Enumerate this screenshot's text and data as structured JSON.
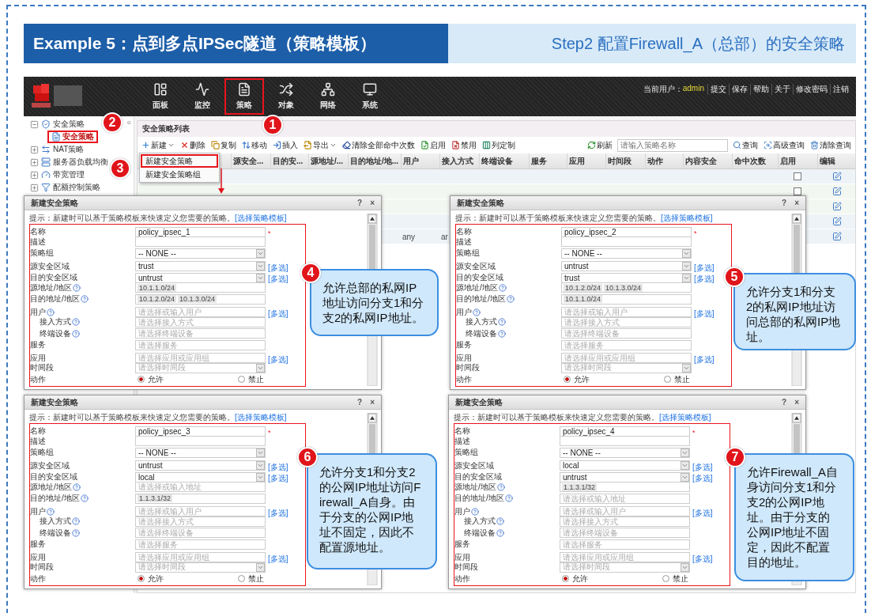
{
  "slide_title": "Example 5：点到多点IPSec隧道（策略模板）",
  "step_title": "Step2 配置Firewall_A（总部）的安全策略",
  "app": {
    "nav": [
      {
        "label": "面板",
        "selected": false
      },
      {
        "label": "监控",
        "selected": false
      },
      {
        "label": "策略",
        "selected": true
      },
      {
        "label": "对象",
        "selected": false
      },
      {
        "label": "网络",
        "selected": false
      },
      {
        "label": "系统",
        "selected": false
      }
    ],
    "user_label": "当前用户：",
    "user": "admin",
    "header_links": [
      "提交",
      "保存",
      "帮助",
      "关于",
      "修改密码",
      "注销"
    ],
    "sidebar": {
      "collapse": "«",
      "items": [
        {
          "label": "安全策略",
          "expanded": true,
          "children": [
            {
              "label": "安全策略",
              "selected": true
            }
          ]
        },
        {
          "label": "NAT策略",
          "expanded": false
        },
        {
          "label": "服务器负载均衡",
          "expanded": false
        },
        {
          "label": "带宽管理",
          "expanded": false
        },
        {
          "label": "配额控制策略",
          "expanded": false
        }
      ]
    },
    "panel_title": "安全策略列表",
    "toolbar": [
      {
        "label": "新建",
        "menu": true
      },
      {
        "label": "删除"
      },
      {
        "label": "复制"
      },
      {
        "label": "移动"
      },
      {
        "label": "插入"
      },
      {
        "label": "导出",
        "menu": true
      },
      {
        "label": "清除全部命中次数"
      },
      {
        "label": "启用"
      },
      {
        "label": "禁用"
      },
      {
        "label": "列定制"
      }
    ],
    "refresh": "刷新",
    "search": {
      "placeholder": "请输入策略名称"
    },
    "query_tools": [
      "查询",
      "高级查询",
      "清除查询"
    ],
    "dropdown": [
      {
        "label": "新建安全策略",
        "selected": true
      },
      {
        "label": "新建安全策略组",
        "selected": false
      }
    ],
    "columns": [
      "源安全...",
      "目的安...",
      "源地址/...",
      "目的地址/地...",
      "用户",
      "接入方式",
      "终端设备",
      "服务",
      "应用",
      "时间段",
      "动作",
      "内容安全",
      "命中次数",
      "启用",
      "编辑"
    ],
    "rows": [
      {
        "enabled": false
      },
      {
        "enabled": false
      },
      {
        "kind": "plain"
      },
      {
        "kind": "plain"
      },
      {
        "user": "any",
        "access": "ar"
      }
    ]
  },
  "dialogs": [
    {
      "title": "新建安全策略",
      "buttons": [
        "?",
        "×"
      ],
      "hint": "提示：新建时可以基于策略模板来快速定义您需要的策略。",
      "hint_link": "[选择策略模板]",
      "fields": [
        {
          "label": "名称",
          "kind": "text",
          "value": "policy_ipsec_1",
          "mark": "*"
        },
        {
          "label": "描述",
          "kind": "text"
        },
        {
          "label": "策略组",
          "kind": "select",
          "value": "-- NONE --"
        },
        {
          "label": "源安全区域",
          "kind": "select",
          "value": "trust",
          "link": "[多选]"
        },
        {
          "label": "目的安全区域",
          "kind": "select",
          "value": "untrust",
          "link": "[多选]"
        },
        {
          "label": "源地址/地区",
          "kind": "tags",
          "help": true,
          "tags": [
            "10.1.1.0/24"
          ]
        },
        {
          "label": "目的地址/地区",
          "kind": "tags",
          "help": true,
          "tags": [
            "10.1.2.0/24",
            "10.1.3.0/24"
          ]
        },
        {
          "label": "用户",
          "kind": "text",
          "help": true,
          "placeholder": "请选择或输入用户",
          "link": "[多选]"
        },
        {
          "label": "接入方式",
          "kind": "text",
          "help": true,
          "indent": true,
          "placeholder": "请选择接入方式"
        },
        {
          "label": "终端设备",
          "kind": "text",
          "help": true,
          "indent": true,
          "placeholder": "请选择终端设备"
        },
        {
          "label": "服务",
          "kind": "text",
          "placeholder": "请选择服务"
        },
        {
          "label": "应用",
          "kind": "text",
          "placeholder": "请选择应用或应用组",
          "link": "[多选]"
        },
        {
          "label": "时间段",
          "kind": "select",
          "placeholder": "请选择时间段"
        },
        {
          "label": "动作",
          "kind": "radio",
          "options": [
            {
              "label": "允许",
              "selected": true
            },
            {
              "label": "禁止",
              "selected": false
            }
          ]
        }
      ]
    },
    {
      "title": "新建安全策略",
      "buttons": [
        "?",
        "×"
      ],
      "hint": "提示：新建时可以基于策略模板来快速定义您需要的策略。",
      "hint_link": "[选择策略模板]",
      "fields": [
        {
          "label": "名称",
          "kind": "text",
          "value": "policy_ipsec_2",
          "mark": "*"
        },
        {
          "label": "描述",
          "kind": "text"
        },
        {
          "label": "策略组",
          "kind": "select",
          "value": "-- NONE --"
        },
        {
          "label": "源安全区域",
          "kind": "select",
          "value": "untrust",
          "link": "[多选]"
        },
        {
          "label": "目的安全区域",
          "kind": "select",
          "value": "trust",
          "link": "[多选]"
        },
        {
          "label": "源地址/地区",
          "kind": "tags",
          "help": true,
          "tags": [
            "10.1.2.0/24",
            "10.1.3.0/24"
          ]
        },
        {
          "label": "目的地址/地区",
          "kind": "tags",
          "help": true,
          "tags": [
            "10.1.1.0/24"
          ]
        },
        {
          "label": "用户",
          "kind": "text",
          "help": true,
          "placeholder": "请选择或输入用户",
          "link": "[多选]"
        },
        {
          "label": "接入方式",
          "kind": "text",
          "help": true,
          "indent": true,
          "placeholder": "请选择接入方式"
        },
        {
          "label": "终端设备",
          "kind": "text",
          "help": true,
          "indent": true,
          "placeholder": "请选择终端设备"
        },
        {
          "label": "服务",
          "kind": "text",
          "placeholder": "请选择服务"
        },
        {
          "label": "应用",
          "kind": "text",
          "placeholder": "请选择应用或应用组",
          "link": "[多选]"
        },
        {
          "label": "时间段",
          "kind": "select",
          "placeholder": "请选择时间段"
        },
        {
          "label": "动作",
          "kind": "radio",
          "options": [
            {
              "label": "允许",
              "selected": true
            },
            {
              "label": "禁止",
              "selected": false
            }
          ]
        }
      ]
    },
    {
      "title": "新建安全策略",
      "buttons": [
        "?",
        "×"
      ],
      "hint": "提示：新建时可以基于策略模板来快速定义您需要的策略。",
      "hint_link": "[选择策略模板]",
      "fields": [
        {
          "label": "名称",
          "kind": "text",
          "value": "policy_ipsec_3",
          "mark": "*"
        },
        {
          "label": "描述",
          "kind": "text"
        },
        {
          "label": "策略组",
          "kind": "select",
          "value": "-- NONE --"
        },
        {
          "label": "源安全区域",
          "kind": "select",
          "value": "untrust",
          "link": "[多选]"
        },
        {
          "label": "目的安全区域",
          "kind": "select",
          "value": "local",
          "link": "[多选]"
        },
        {
          "label": "源地址/地区",
          "kind": "text",
          "help": true,
          "placeholder": "请选择或输入地址"
        },
        {
          "label": "目的地址/地区",
          "kind": "tags",
          "help": true,
          "tags": [
            "1.1.3.1/32"
          ]
        },
        {
          "label": "用户",
          "kind": "text",
          "help": true,
          "placeholder": "请选择或输入用户",
          "link": "[多选]"
        },
        {
          "label": "接入方式",
          "kind": "text",
          "help": true,
          "indent": true,
          "placeholder": "请选择接入方式"
        },
        {
          "label": "终端设备",
          "kind": "text",
          "help": true,
          "indent": true,
          "placeholder": "请选择终端设备"
        },
        {
          "label": "服务",
          "kind": "text",
          "placeholder": "请选择服务"
        },
        {
          "label": "应用",
          "kind": "text",
          "placeholder": "请选择应用或应用组",
          "link": "[多选]"
        },
        {
          "label": "时间段",
          "kind": "select",
          "placeholder": "请选择时间段"
        },
        {
          "label": "动作",
          "kind": "radio",
          "options": [
            {
              "label": "允许",
              "selected": true
            },
            {
              "label": "禁止",
              "selected": false
            }
          ]
        }
      ]
    },
    {
      "title": "新建安全策略",
      "buttons": [
        "?",
        "×"
      ],
      "hint": "提示：新建时可以基于策略模板来快速定义您需要的策略。",
      "hint_link": "[选择策略模板]",
      "fields": [
        {
          "label": "名称",
          "kind": "text",
          "value": "policy_ipsec_4",
          "mark": "*"
        },
        {
          "label": "描述",
          "kind": "text"
        },
        {
          "label": "策略组",
          "kind": "select",
          "value": "-- NONE --"
        },
        {
          "label": "源安全区域",
          "kind": "select",
          "value": "local",
          "link": "[多选]"
        },
        {
          "label": "目的安全区域",
          "kind": "select",
          "value": "untrust",
          "link": "[多选]"
        },
        {
          "label": "源地址/地区",
          "kind": "tags",
          "help": true,
          "tags": [
            "1.1.3.1/32"
          ]
        },
        {
          "label": "目的地址/地区",
          "kind": "text",
          "help": true,
          "placeholder": "请选择或输入地址"
        },
        {
          "label": "用户",
          "kind": "text",
          "help": true,
          "placeholder": "请选择或输入用户",
          "link": "[多选]"
        },
        {
          "label": "接入方式",
          "kind": "text",
          "help": true,
          "indent": true,
          "placeholder": "请选择接入方式"
        },
        {
          "label": "终端设备",
          "kind": "text",
          "help": true,
          "indent": true,
          "placeholder": "请选择终端设备"
        },
        {
          "label": "服务",
          "kind": "text",
          "placeholder": "请选择服务"
        },
        {
          "label": "应用",
          "kind": "text",
          "placeholder": "请选择应用或应用组",
          "link": "[多选]"
        },
        {
          "label": "时间段",
          "kind": "select",
          "placeholder": "请选择时间段"
        },
        {
          "label": "动作",
          "kind": "radio",
          "options": [
            {
              "label": "允许",
              "selected": true
            },
            {
              "label": "禁止",
              "selected": false
            }
          ]
        }
      ]
    }
  ],
  "steps": [
    "1",
    "2",
    "3"
  ],
  "callouts": [
    {
      "number": "4",
      "text": "允许总部的私网IP地址访问分支1和分支2的私网IP地址。"
    },
    {
      "number": "5",
      "text": "允许分支1和分支2的私网IP地址访问总部的私网IP地址。"
    },
    {
      "number": "6",
      "text": "允许分支1和分支2的公网IP地址访问Firewall_A自身。由于分支的公网IP地址不固定，因此不配置源地址。"
    },
    {
      "number": "7",
      "text": "允许Firewall_A自身访问分支1和分支2的公网IP地址。由于分支的公网IP地址不固定，因此不配置目的地址。"
    }
  ]
}
